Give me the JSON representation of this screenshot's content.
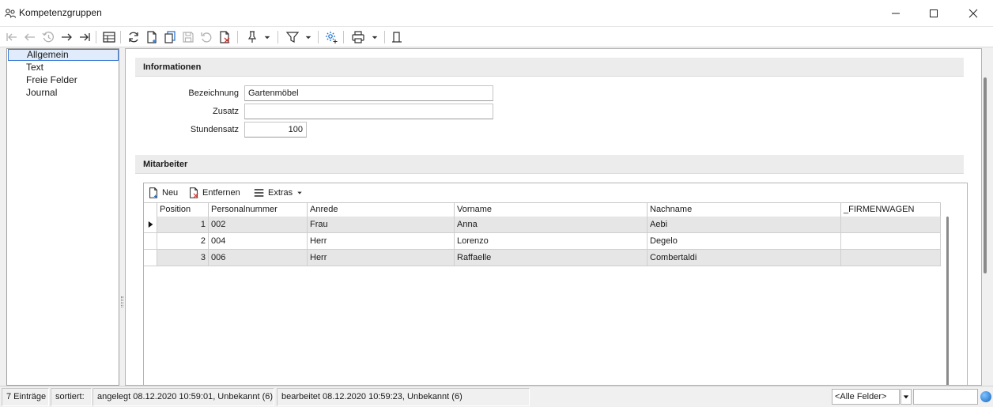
{
  "window": {
    "title": "Kompetenzgruppen",
    "icons": {
      "app": "group-icon",
      "minimize": "minimize-icon",
      "maximize": "maximize-icon",
      "close": "close-icon"
    }
  },
  "toolbar": {
    "icons": [
      "first-record-icon",
      "previous-record-icon",
      "history-icon",
      "next-record-icon",
      "last-record-icon",
      "table-view-icon",
      "refresh-icon",
      "new-document-icon",
      "copy-icon",
      "save-icon",
      "undo-icon",
      "delete-icon",
      "pin-icon",
      "pin-dropdown-icon",
      "filter-icon",
      "filter-dropdown-icon",
      "settings-icon",
      "print-icon",
      "print-dropdown-icon",
      "layout-icon"
    ]
  },
  "sidebar": {
    "items": [
      {
        "label": "Allgemein",
        "selected": true
      },
      {
        "label": "Text",
        "selected": false
      },
      {
        "label": "Freie Felder",
        "selected": false
      },
      {
        "label": "Journal",
        "selected": false
      }
    ]
  },
  "informationen": {
    "header": "Informationen",
    "fields": {
      "bezeichnung": {
        "label": "Bezeichnung",
        "value": "Gartenmöbel"
      },
      "zusatz": {
        "label": "Zusatz",
        "value": ""
      },
      "stundensatz": {
        "label": "Stundensatz",
        "value": "100"
      }
    }
  },
  "mitarbeiter": {
    "header": "Mitarbeiter",
    "toolbar": {
      "neu": "Neu",
      "entfernen": "Entfernen",
      "extras": "Extras"
    },
    "columns": [
      "Position",
      "Personalnummer",
      "Anrede",
      "Vorname",
      "Nachname",
      "_FIRMENWAGEN"
    ],
    "rows": [
      {
        "position": "1",
        "personalnummer": "002",
        "anrede": "Frau",
        "vorname": "Anna",
        "nachname": "Aebi",
        "firmenwagen": ""
      },
      {
        "position": "2",
        "personalnummer": "004",
        "anrede": "Herr",
        "vorname": "Lorenzo",
        "nachname": "Degelo",
        "firmenwagen": ""
      },
      {
        "position": "3",
        "personalnummer": "006",
        "anrede": "Herr",
        "vorname": "Raffaelle",
        "nachname": "Combertaldi",
        "firmenwagen": ""
      }
    ]
  },
  "statusbar": {
    "count": "7 Einträge",
    "sorted": "sortiert:",
    "created": "angelegt 08.12.2020 10:59:01, Unbekannt (6)",
    "edited": "bearbeitet 08.12.2020 10:59:23, Unbekannt (6)",
    "field_filter": "<Alle Felder>",
    "search_value": ""
  },
  "colors": {
    "selection_border": "#3b7bd8",
    "selection_fill": "#e0ecfb",
    "accent_blue": "#1f6fd1",
    "delete_red": "#d03030"
  }
}
